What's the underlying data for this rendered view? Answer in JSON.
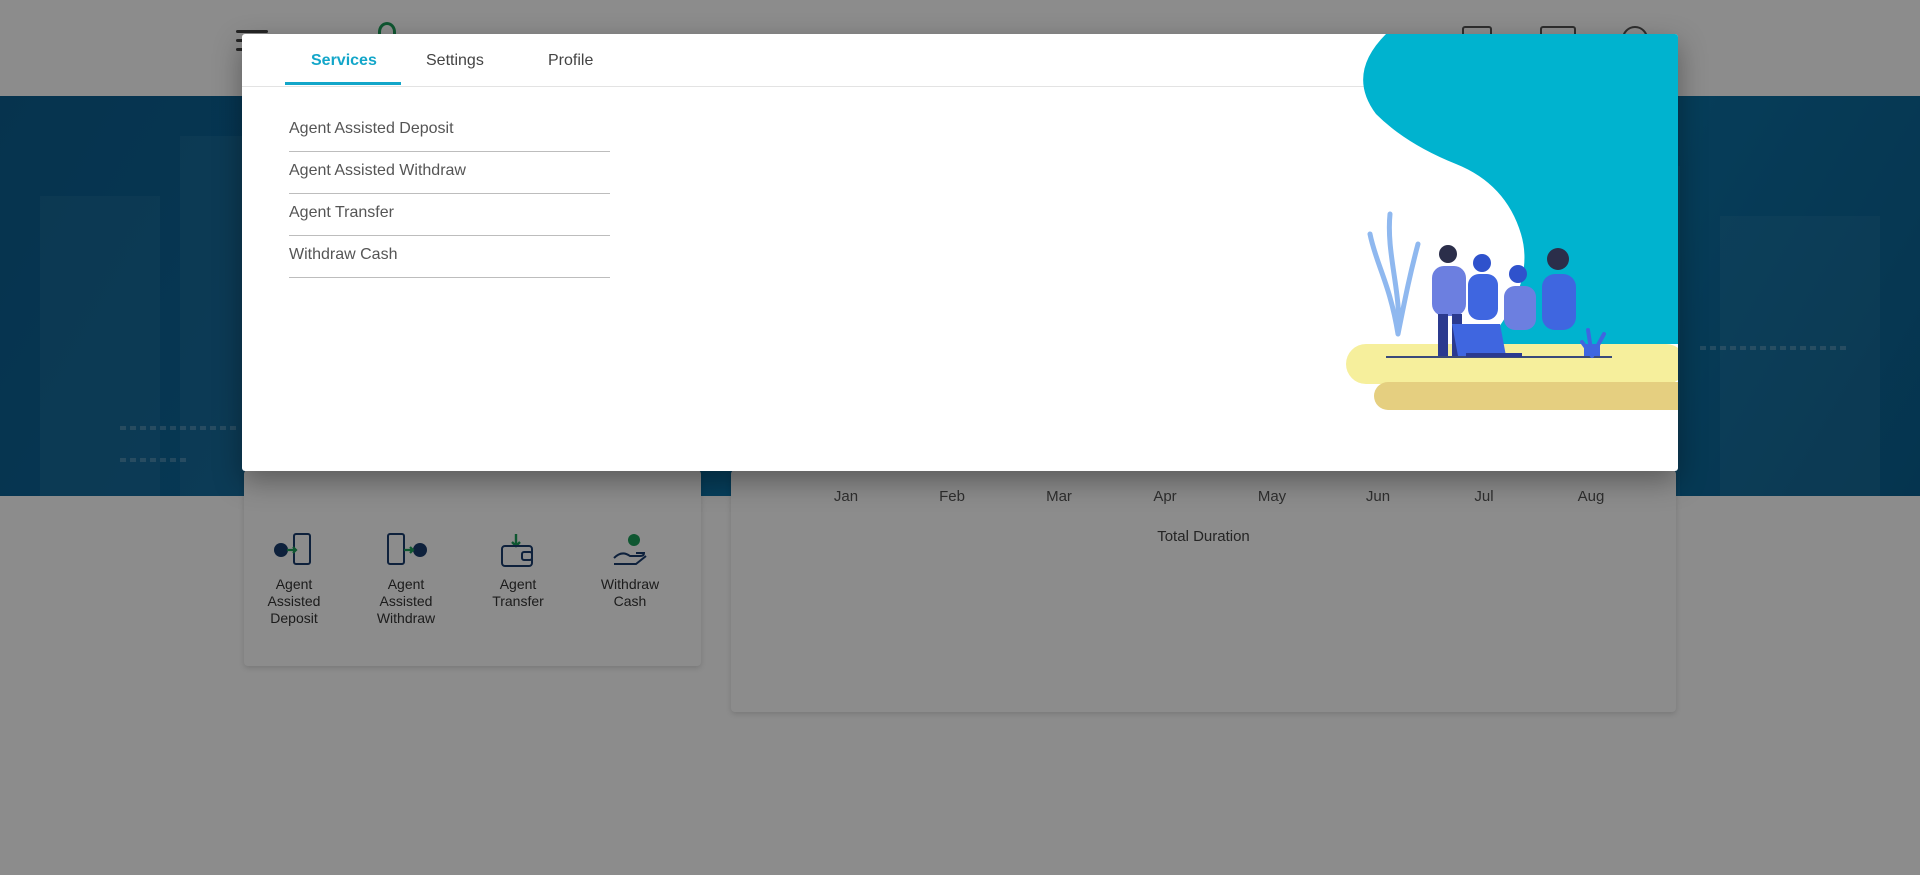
{
  "services_card": {
    "tiles": [
      {
        "label_lines": [
          "Agent",
          "Assisted",
          "Deposit"
        ],
        "icon": "phone-deposit-icon"
      },
      {
        "label_lines": [
          "Agent",
          "Assisted",
          "Withdraw"
        ],
        "icon": "phone-withdraw-icon"
      },
      {
        "label_lines": [
          "Agent",
          "Transfer"
        ],
        "icon": "wallet-transfer-icon"
      },
      {
        "label_lines": [
          "Withdraw",
          "Cash"
        ],
        "icon": "hand-cash-icon"
      }
    ]
  },
  "chart_card": {
    "months": [
      "Jan",
      "Feb",
      "Mar",
      "Apr",
      "May",
      "Jun",
      "Jul",
      "Aug"
    ],
    "title": "Total Duration"
  },
  "modal": {
    "tabs": [
      {
        "label": "Services",
        "active": true
      },
      {
        "label": "Settings",
        "active": false
      },
      {
        "label": "Profile",
        "active": false
      }
    ],
    "menu_items": [
      "Agent Assisted Deposit",
      "Agent Assisted Withdraw",
      "Agent Transfer",
      "Withdraw Cash"
    ],
    "illustration": "team-at-laptop-illustration"
  },
  "colors": {
    "accent": "#13a6c9",
    "hero": "#0a6a9e",
    "blob": "#00b3cf",
    "sand": "#f6ef9c",
    "sand_dark": "#e5cf80",
    "icon_green": "#1d9e5a",
    "icon_navy": "#1a3d6e"
  }
}
